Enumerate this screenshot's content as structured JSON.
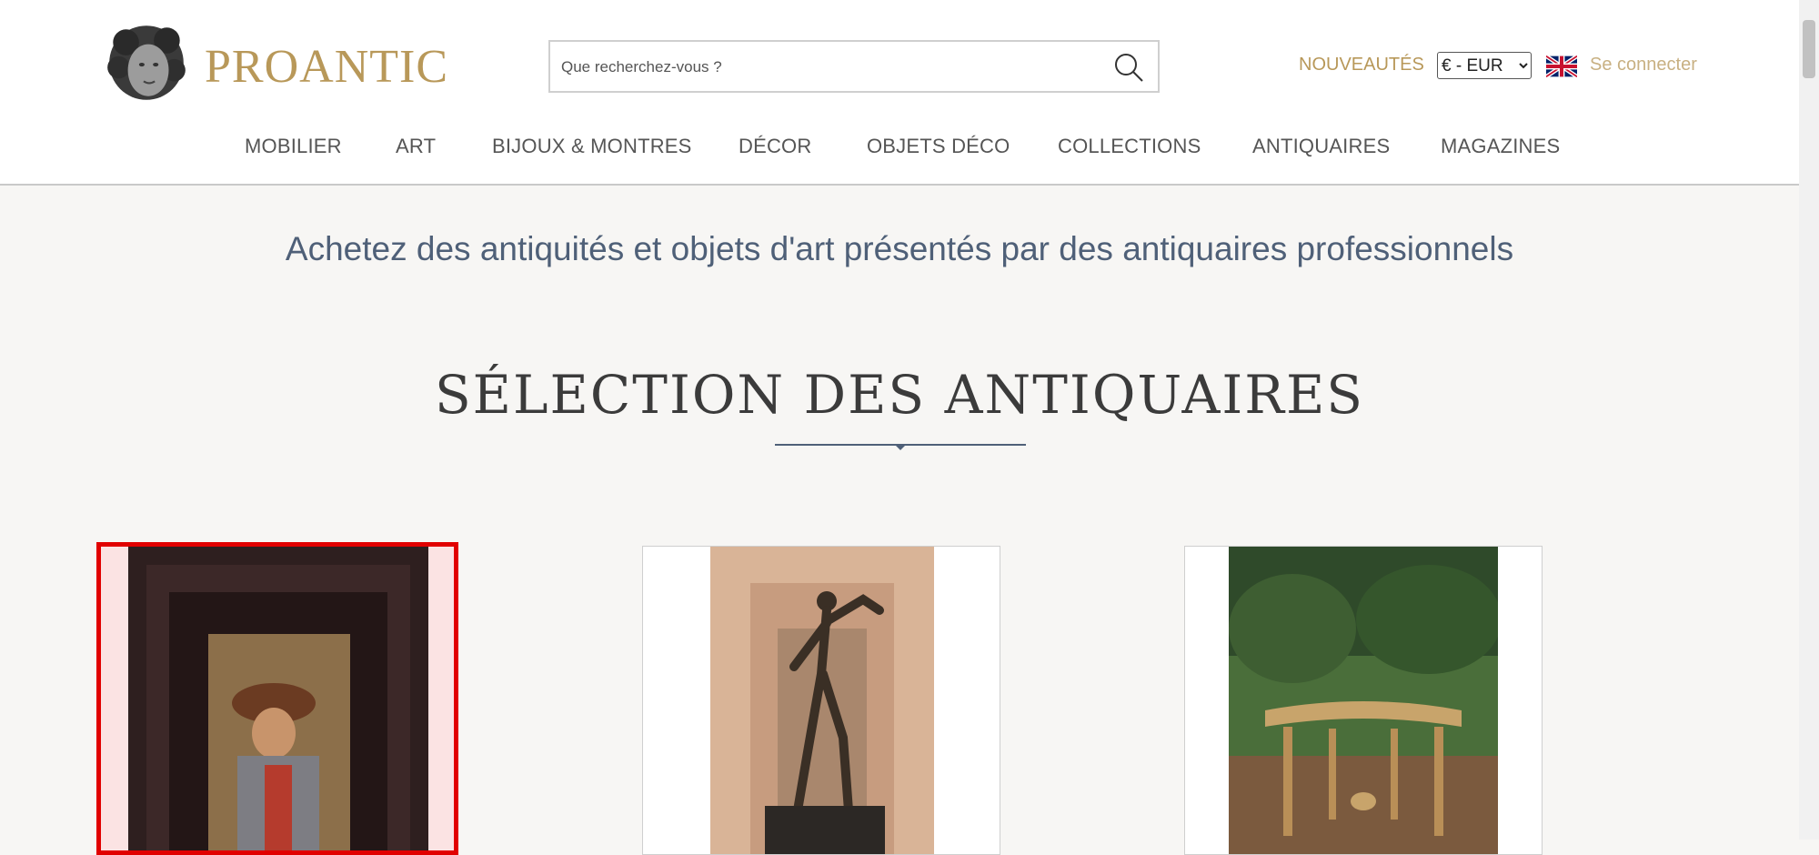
{
  "header": {
    "logo_text": "PROANTIC",
    "search_placeholder": "Que recherchez-vous ?",
    "nouveautes": "NOUVEAUTÉS",
    "currency": "€ - EUR",
    "login": "Se connecter"
  },
  "nav": [
    {
      "label": "MOBILIER"
    },
    {
      "label": "ART"
    },
    {
      "label": "BIJOUX & MONTRES"
    },
    {
      "label": "DÉCOR"
    },
    {
      "label": "OBJETS DÉCO"
    },
    {
      "label": "COLLECTIONS"
    },
    {
      "label": "ANTIQUAIRES"
    },
    {
      "label": "MAGAZINES"
    }
  ],
  "tagline": "Achetez des antiquités et objets d'art présentés par des antiquaires professionnels",
  "section_title": "SÉLECTION DES ANTIQUAIRES",
  "products": [
    {
      "image": "framed-portrait-painting",
      "selected": true
    },
    {
      "image": "bronze-warrior-statue",
      "selected": false
    },
    {
      "image": "gilded-console-table",
      "selected": false
    }
  ],
  "colors": {
    "gold": "#b89859",
    "slate": "#4f6078",
    "background": "#f7f6f4",
    "selection": "#e10000"
  }
}
